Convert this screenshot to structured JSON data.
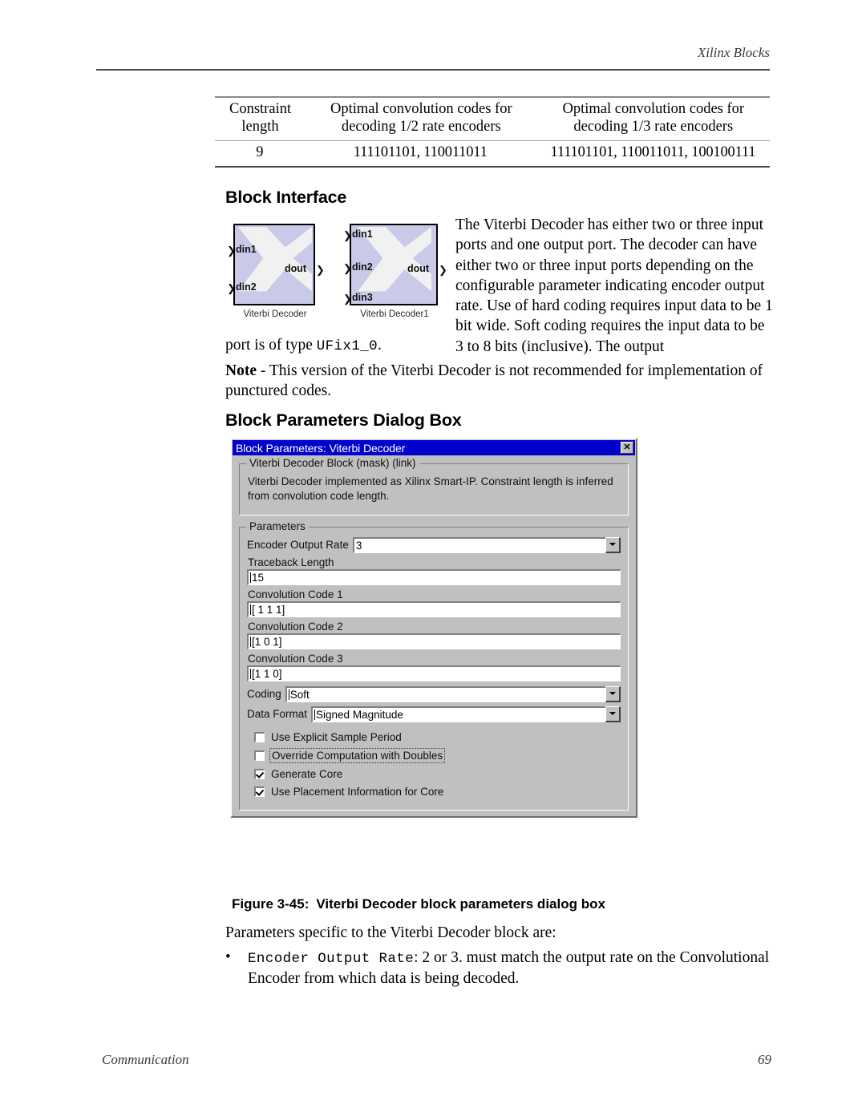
{
  "page": {
    "running_head": "Xilinx Blocks",
    "footer_left": "Communication",
    "footer_page_number": "69"
  },
  "table": {
    "headers": [
      "Constraint length",
      "Optimal convolution codes for decoding 1/2 rate encoders",
      "Optimal convolution codes for decoding 1/3 rate encoders"
    ],
    "headers_line1": [
      "Constraint",
      "Optimal convolution codes for",
      "Optimal convolution codes for"
    ],
    "headers_line2": [
      "length",
      "decoding 1/2 rate encoders",
      "decoding 1/3 rate encoders"
    ],
    "rows": [
      [
        "9",
        "111101101, 110011011",
        "111101101, 110011011, 100100111"
      ]
    ]
  },
  "sections": {
    "block_interface_heading": "Block Interface",
    "dialog_box_heading": "Block Parameters Dialog Box"
  },
  "body": {
    "intro_paragraph": "The Viterbi Decoder has either two or three input ports and one output port. The decoder can have either two or three input ports depending on the configurable parameter indicating encoder output rate. Use of hard coding requires input data to be 1 bit wide.  Soft coding requires the input data to be 3 to 8 bits (inclusive).  The output",
    "port_line_prefix": "port is of type ",
    "port_type": "UFix1_0",
    "port_line_suffix": ".",
    "note_label": "Note",
    "note_text": " - This version of the Viterbi Decoder is not recommended for implementation of punctured codes.",
    "params_intro": "Parameters specific to the Viterbi Decoder block are:",
    "bullet_dot": "•",
    "bullet_mono": "Encoder Output Rate",
    "bullet_rest": ": 2 or 3.  must match the output rate on the Convolutional Encoder from which data is being decoded."
  },
  "blocks": [
    {
      "name": "Viterbi Decoder",
      "inputs": [
        "din1",
        "din2"
      ],
      "output": "dout"
    },
    {
      "name": "Viterbi Decoder1",
      "inputs": [
        "din1",
        "din2",
        "din3"
      ],
      "output": "dout"
    }
  ],
  "dialog": {
    "title": "Block Parameters: Viterbi Decoder",
    "close_label": "✕",
    "mask_group_legend": "Viterbi Decoder Block (mask) (link)",
    "mask_description": "Viterbi Decoder implemented as Xilinx Smart-IP.  Constraint length is inferred from convolution code length.",
    "params_group_legend": "Parameters",
    "encoder_output_rate": {
      "label": "Encoder Output Rate",
      "value": "3"
    },
    "traceback_length": {
      "label": "Traceback Length",
      "value": "15"
    },
    "convolution_code_1": {
      "label": "Convolution Code 1",
      "value": "[ 1 1 1]"
    },
    "convolution_code_2": {
      "label": "Convolution Code 2",
      "value": "[1 0 1]"
    },
    "convolution_code_3": {
      "label": "Convolution Code 3",
      "value": "[1 1 0]"
    },
    "coding": {
      "label": "Coding",
      "value": "Soft"
    },
    "data_format": {
      "label": "Data Format",
      "value": "Signed Magnitude"
    },
    "checkboxes": [
      {
        "label": "Use Explicit Sample Period",
        "checked": false,
        "focused": false
      },
      {
        "label": "Override Computation with Doubles",
        "checked": false,
        "focused": true
      },
      {
        "label": "Generate Core",
        "checked": true,
        "focused": false
      },
      {
        "label": "Use Placement Information for Core",
        "checked": true,
        "focused": false
      }
    ]
  },
  "figure": {
    "number": "Figure 3-45:",
    "caption": "Viterbi Decoder block parameters dialog box"
  },
  "colors": {
    "titlebar": "#0000cc",
    "dialog_face": "#c0c0c0",
    "block_fill": "#c9c9e8",
    "rule": "#4a4a4a"
  }
}
